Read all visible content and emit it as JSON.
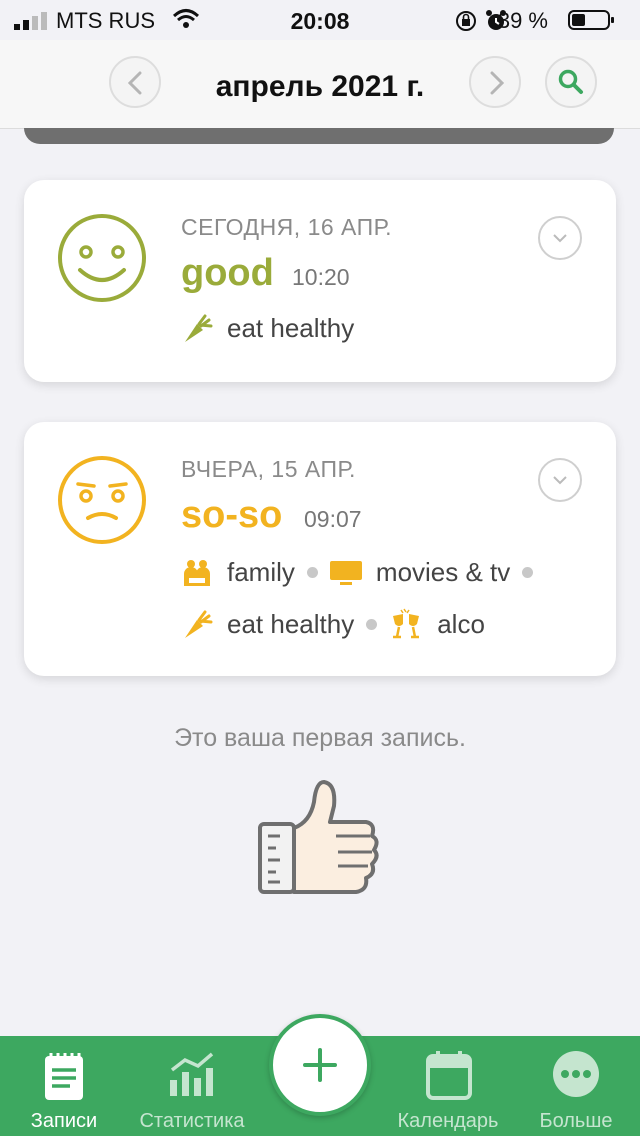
{
  "status_bar": {
    "carrier": "MTS RUS",
    "time": "20:08",
    "battery": "39 %"
  },
  "header": {
    "title": "апрель 2021 г.",
    "prev_icon": "chevron-left-icon",
    "next_icon": "chevron-right-icon",
    "search_icon": "search-icon"
  },
  "entries": [
    {
      "date": "СЕГОДНЯ, 16 АПР.",
      "mood": "good",
      "time": "10:20",
      "mood_color": "#9aab3a",
      "face_icon": "smile-face-icon",
      "tags": [
        {
          "label": "eat healthy",
          "icon": "carrot-icon"
        }
      ]
    },
    {
      "date": "ВЧЕРА, 15 АПР.",
      "mood": "so-so",
      "time": "09:07",
      "mood_color": "#f2b320",
      "face_icon": "meh-face-icon",
      "tags": [
        {
          "label": "family",
          "icon": "family-icon"
        },
        {
          "label": "movies & tv",
          "icon": "tv-icon"
        },
        {
          "label": "eat healthy",
          "icon": "carrot-icon"
        },
        {
          "label": "alco",
          "icon": "glasses-cheers-icon"
        }
      ]
    }
  ],
  "first_entry_note": "Это ваша первая запись.",
  "tabbar": {
    "color": "#3da860",
    "tabs": [
      {
        "label": "Записи",
        "icon": "notes-icon"
      },
      {
        "label": "Статистика",
        "icon": "stats-icon"
      },
      {
        "label": "Календарь",
        "icon": "calendar-icon"
      },
      {
        "label": "Больше",
        "icon": "more-icon"
      }
    ],
    "add_icon": "plus-icon"
  }
}
